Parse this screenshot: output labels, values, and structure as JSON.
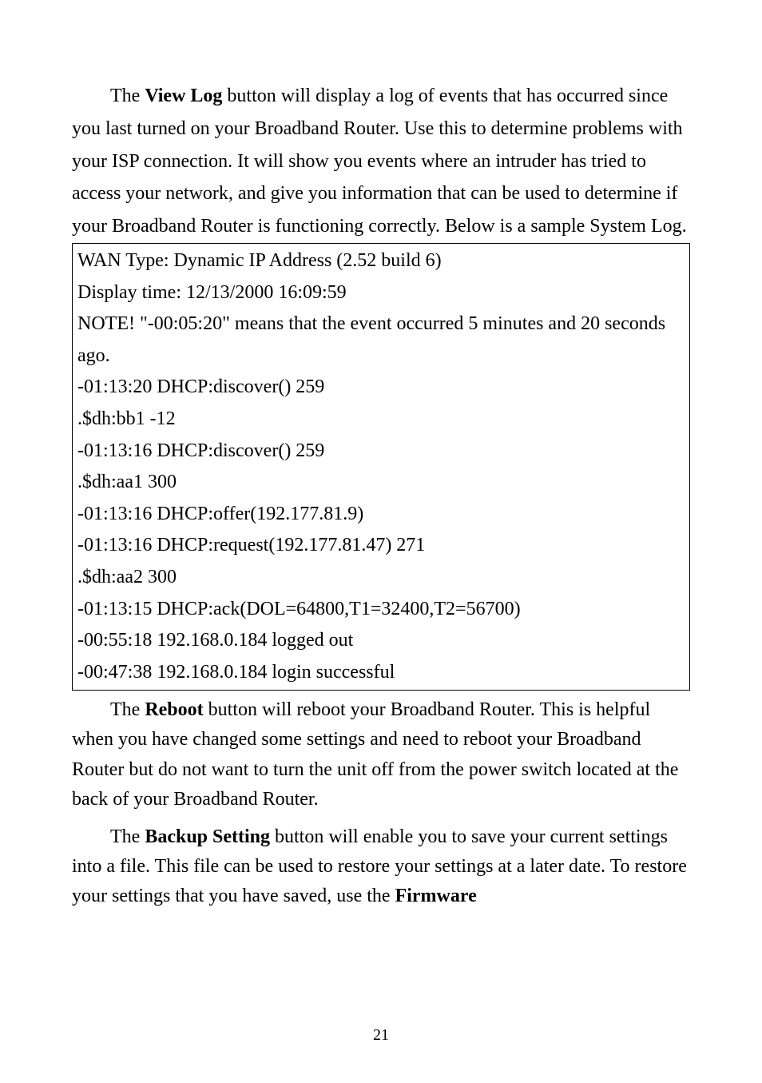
{
  "intro": {
    "pre1": "The ",
    "bold1": "View Log",
    "post1": " button will display a log of events that has occurred since you last turned on your Broadband Router. Use this to determine problems with your ISP connection. It will show you events where an intruder has tried to access your network, and give you information that can be used to determine if your Broadband Router is functioning correctly. Below is a sample System Log."
  },
  "log": {
    "l1": "WAN Type: Dynamic IP Address (2.52 build 6)",
    "l2": "Display time: 12/13/2000 16:09:59",
    "l3": "NOTE! \"-00:05:20\" means that the event occurred 5 minutes and 20 seconds ago.",
    "l4": "-01:13:20 DHCP:discover() 259",
    "l5": ".$dh:bb1 -12",
    "l6": "-01:13:16 DHCP:discover() 259",
    "l7": ".$dh:aa1 300",
    "l8": "-01:13:16 DHCP:offer(192.177.81.9)",
    "l9": "-01:13:16 DHCP:request(192.177.81.47) 271",
    "l10": ".$dh:aa2 300",
    "l11": "-01:13:15 DHCP:ack(DOL=64800,T1=32400,T2=56700)",
    "l12": "-00:55:18 192.168.0.184 logged out",
    "l13": "-00:47:38 192.168.0.184 login successful"
  },
  "reboot": {
    "pre": "The ",
    "bold": "Reboot",
    "post": " button will reboot your Broadband Router. This is helpful when you have changed some settings and need to reboot your Broadband Router but do not want to turn the unit off from the power switch located at the back of your Broadband Router."
  },
  "backup": {
    "pre": "The ",
    "bold": "Backup Setting",
    "mid": " button will enable you to save your current settings into a file. This file can be used to restore your settings at a later date. To restore your settings that you have saved, use the ",
    "bold2": "Firmware"
  },
  "pageNumber": "21"
}
